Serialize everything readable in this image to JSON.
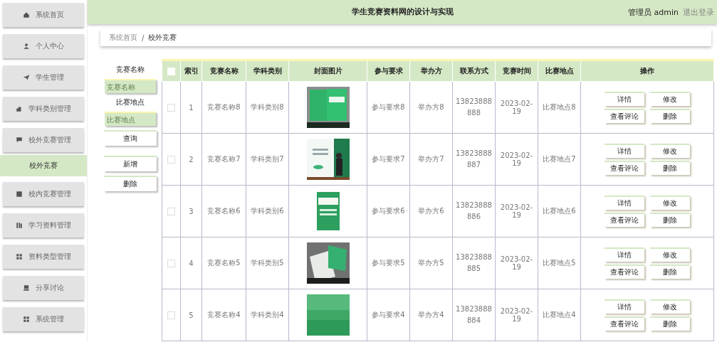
{
  "sidebar": {
    "items": [
      {
        "label": "系统首页",
        "selected": false
      },
      {
        "label": "个人中心",
        "selected": false
      },
      {
        "label": "学生管理",
        "selected": false
      },
      {
        "label": "学科类别管理",
        "selected": false
      },
      {
        "label": "校外竞赛管理",
        "selected": false,
        "children": [
          {
            "label": "校外竞赛",
            "selected": true
          }
        ]
      },
      {
        "label": "校内竞赛管理",
        "selected": false
      },
      {
        "label": "学习资料管理",
        "selected": false
      },
      {
        "label": "资料类型管理",
        "selected": false
      },
      {
        "label": "分享讨论",
        "selected": false
      },
      {
        "label": "系统管理",
        "selected": false
      }
    ]
  },
  "header": {
    "title": "学生竞赛资料网的设计与实现",
    "user": "管理员 admin",
    "logout": "退出登录"
  },
  "breadcrumb": {
    "items": [
      "系统首页",
      "校外竞赛"
    ],
    "separator": "/"
  },
  "search": {
    "fields": [
      {
        "label": "竞赛名称",
        "placeholder": "竞赛名称"
      },
      {
        "label": "比赛地点",
        "placeholder": "比赛地点"
      }
    ],
    "buttons": [
      "查询",
      "新增",
      "删除"
    ]
  },
  "table": {
    "select_all_checked": false,
    "columns": [
      "索引",
      "竞赛名称",
      "学科类别",
      "封面图片",
      "参与要求",
      "举办方",
      "联系方式",
      "竞赛时间",
      "比赛地点",
      "操作"
    ],
    "rows": [
      {
        "checked": false,
        "index": "1",
        "name": "竞赛名称8",
        "category": "学科类别8",
        "cover": {
          "kind": "picture"
        },
        "requirement": "参与要求8",
        "organizer": "举办方8",
        "contact": "13823888888",
        "date": "2023-02-19",
        "venue": "比赛地点8",
        "actions": [
          "详情",
          "修改",
          "查看评论",
          "删除"
        ]
      },
      {
        "checked": false,
        "index": "2",
        "name": "竞赛名称7",
        "category": "学科类别7",
        "cover": {
          "kind": "picture"
        },
        "requirement": "参与要求7",
        "organizer": "举办方7",
        "contact": "13823888887",
        "date": "2023-02-19",
        "venue": "比赛地点7",
        "actions": [
          "详情",
          "修改",
          "查看评论",
          "删除"
        ]
      },
      {
        "checked": false,
        "index": "3",
        "name": "竞赛名称6",
        "category": "学科类别6",
        "cover": {
          "kind": "picture"
        },
        "requirement": "参与要求6",
        "organizer": "举办方6",
        "contact": "13823888886",
        "date": "2023-02-19",
        "venue": "比赛地点6",
        "actions": [
          "详情",
          "修改",
          "查看评论",
          "删除"
        ]
      },
      {
        "checked": false,
        "index": "4",
        "name": "竞赛名称5",
        "category": "学科类别5",
        "cover": {
          "kind": "picture"
        },
        "requirement": "参与要求5",
        "organizer": "举办方5",
        "contact": "13823888885",
        "date": "2023-02-19",
        "venue": "比赛地点5",
        "actions": [
          "详情",
          "修改",
          "查看评论",
          "删除"
        ]
      },
      {
        "checked": false,
        "index": "5",
        "name": "竞赛名称4",
        "category": "学科类别4",
        "cover": {
          "kind": "picture"
        },
        "requirement": "参与要求4",
        "organizer": "举办方4",
        "contact": "13823888884",
        "date": "2023-02-19",
        "venue": "比赛地点4",
        "actions": [
          "详情",
          "修改",
          "查看评论",
          "删除"
        ]
      }
    ]
  }
}
